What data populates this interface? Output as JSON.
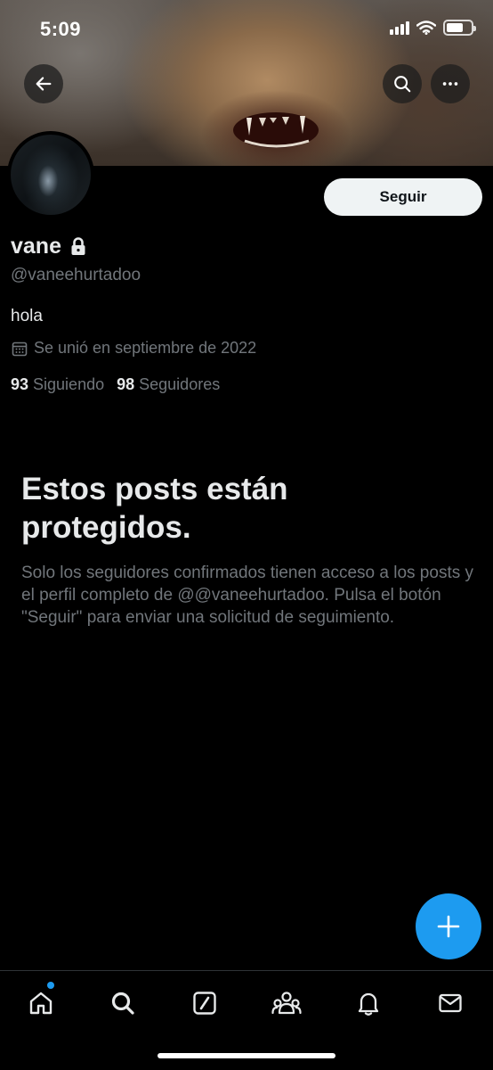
{
  "status_bar": {
    "time": "5:09",
    "signal_icon": "cellular-signal-icon",
    "wifi_icon": "wifi-icon",
    "battery_icon": "battery-icon",
    "battery_level": 0.7
  },
  "header": {
    "back_icon": "arrow-left-icon",
    "search_icon": "search-icon",
    "more_icon": "more-horizontal-icon"
  },
  "profile": {
    "display_name": "vane",
    "lock_icon": "lock-icon",
    "handle": "@vaneehurtadoo",
    "bio": "hola",
    "calendar_icon": "calendar-icon",
    "joined": "Se unió en septiembre de 2022",
    "following_count": "93",
    "following_label": "Siguiendo",
    "followers_count": "98",
    "followers_label": "Seguidores",
    "follow_button_label": "Seguir"
  },
  "protected": {
    "title": "Estos posts están protegidos.",
    "description": "Solo los seguidores confirmados tienen acceso a los posts y el perfil completo de @@vaneehurtadoo. Pulsa el botón \"Seguir\" para enviar una solicitud de seguimiento."
  },
  "fab": {
    "icon": "plus-icon"
  },
  "bottom_nav": {
    "items": [
      {
        "icon": "home-icon",
        "has_dot": true
      },
      {
        "icon": "search-icon"
      },
      {
        "icon": "grok-icon"
      },
      {
        "icon": "communities-icon"
      },
      {
        "icon": "notifications-bell-icon"
      },
      {
        "icon": "messages-envelope-icon"
      }
    ]
  },
  "colors": {
    "accent": "#1d9bf0",
    "background": "#000000",
    "text_primary": "#e7e9ea",
    "text_secondary": "#71767b",
    "follow_button_bg": "#eff3f4"
  }
}
